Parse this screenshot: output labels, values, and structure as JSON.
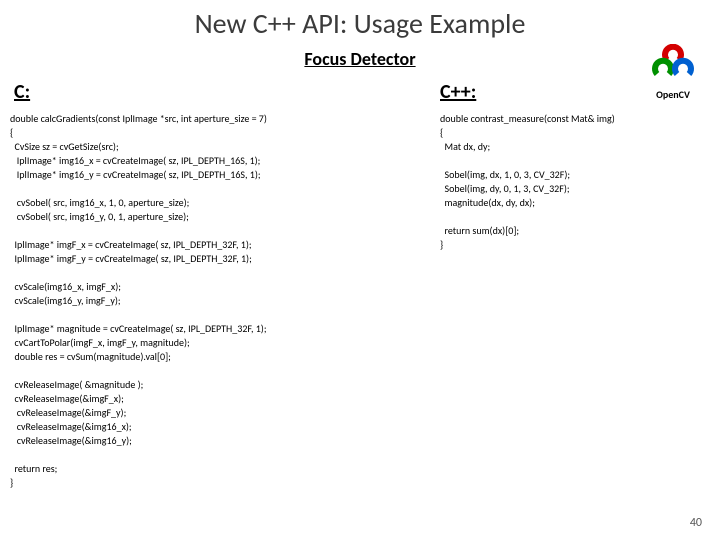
{
  "title": "New C++ API: Usage Example",
  "subtitle": "Focus Detector",
  "logo": {
    "label": "OpenCV"
  },
  "columns": {
    "c_header": "C:",
    "cpp_header": "C++:"
  },
  "code_c": "double calcGradients(const IplImage *src, int aperture_size = 7)\n{\n  CvSize sz = cvGetSize(src);\n   IplImage* img16_x = cvCreateImage( sz, IPL_DEPTH_16S, 1);\n   IplImage* img16_y = cvCreateImage( sz, IPL_DEPTH_16S, 1);\n\n   cvSobel( src, img16_x, 1, 0, aperture_size);\n   cvSobel( src, img16_y, 0, 1, aperture_size);\n\n  IplImage* imgF_x = cvCreateImage( sz, IPL_DEPTH_32F, 1);\n  IplImage* imgF_y = cvCreateImage( sz, IPL_DEPTH_32F, 1);\n\n  cvScale(img16_x, imgF_x);\n  cvScale(img16_y, imgF_y);\n\n  IplImage* magnitude = cvCreateImage( sz, IPL_DEPTH_32F, 1);\n  cvCartToPolar(imgF_x, imgF_y, magnitude);\n  double res = cvSum(magnitude).val[0];\n\n  cvReleaseImage( &magnitude );\n  cvReleaseImage(&imgF_x);\n   cvReleaseImage(&imgF_y);\n   cvReleaseImage(&img16_x);\n   cvReleaseImage(&img16_y);\n\n  return res;\n}",
  "code_cpp": "double contrast_measure(const Mat& img)\n{\n  Mat dx, dy;\n\n  Sobel(img, dx, 1, 0, 3, CV_32F);\n  Sobel(img, dy, 0, 1, 3, CV_32F);\n  magnitude(dx, dy, dx);\n\n  return sum(dx)[0];\n}",
  "page_number": "40"
}
